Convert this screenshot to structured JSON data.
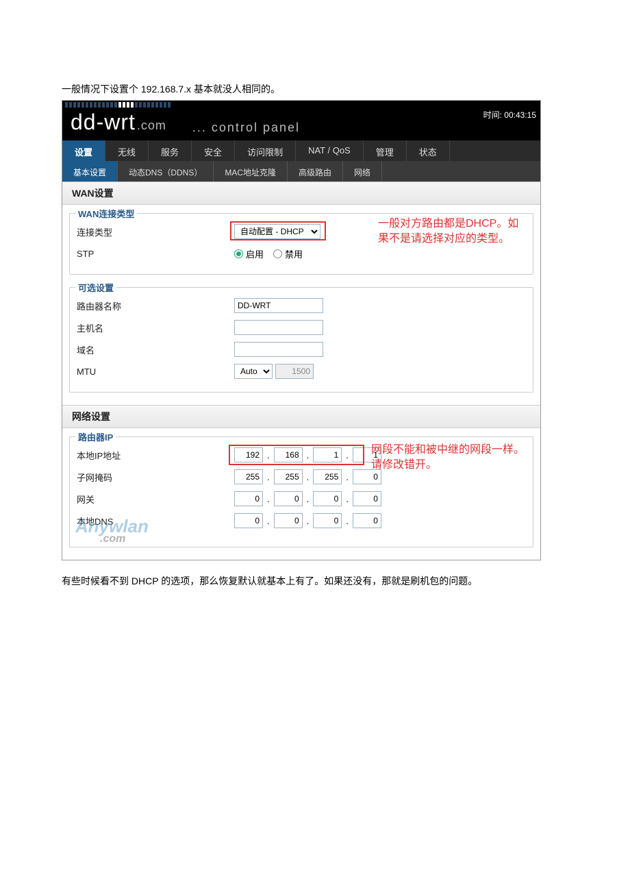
{
  "intro": "一般情况下设置个 192.168.7.x 基本就没人相同的。",
  "time_label": "时间: 00:43:15",
  "logo": {
    "prefix": "dd-wrt",
    "suffix": ".com"
  },
  "control_panel": "... control panel",
  "main_tabs": [
    "设置",
    "无线",
    "服务",
    "安全",
    "访问限制",
    "NAT / QoS",
    "管理",
    "状态"
  ],
  "main_active": 0,
  "sub_tabs": [
    "基本设置",
    "动态DNS（DDNS）",
    "MAC地址克隆",
    "高级路由",
    "网络"
  ],
  "sub_active": 0,
  "section1_header": "WAN设置",
  "fs1_legend": "WAN连接类型",
  "fs1_rows": {
    "conn_type_label": "连接类型",
    "conn_type_value": "自动配置 - DHCP",
    "stp_label": "STP",
    "stp_enable": "启用",
    "stp_disable": "禁用"
  },
  "annot1": "一般对方路由都是DHCP。如果不是请选择对应的类型。",
  "fs2_legend": "可选设置",
  "fs2": {
    "router_name_label": "路由器名称",
    "router_name_value": "DD-WRT",
    "hostname_label": "主机名",
    "hostname_value": "",
    "domain_label": "域名",
    "domain_value": "",
    "mtu_label": "MTU",
    "mtu_mode": "Auto",
    "mtu_value": "1500"
  },
  "section2_header": "网络设置",
  "fs3_legend": "路由器IP",
  "fs3": {
    "local_ip_label": "本地IP地址",
    "local_ip": [
      "192",
      "168",
      "1",
      "1"
    ],
    "subnet_label": "子网掩码",
    "subnet": [
      "255",
      "255",
      "255",
      "0"
    ],
    "gateway_label": "网关",
    "gateway": [
      "0",
      "0",
      "0",
      "0"
    ],
    "localdns_label": "本地DNS",
    "localdns": [
      "0",
      "0",
      "0",
      "0"
    ]
  },
  "annot2": "网段不能和被中继的网段一样。请修改错开。",
  "watermark": {
    "name": "Anywlan",
    "suffix": ".com"
  },
  "after": "有些时候看不到 DHCP 的选项，那么恢复默认就基本上有了。如果还没有，那就是刷机包的问题。"
}
